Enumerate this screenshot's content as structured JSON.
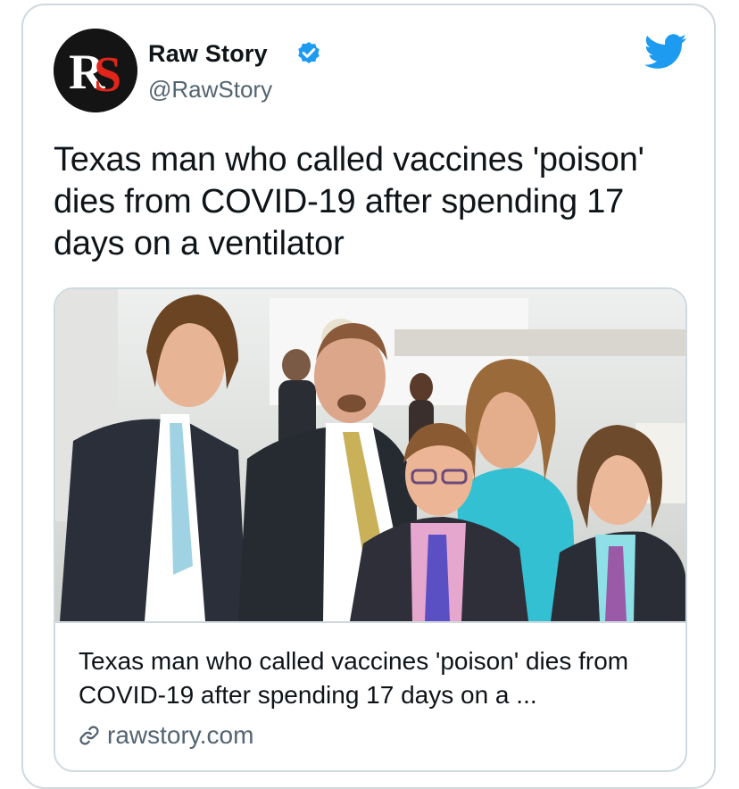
{
  "author": {
    "name": "Raw Story",
    "handle": "@RawStory",
    "avatar_text": "RS",
    "verified": true
  },
  "tweet": {
    "text": "Texas man who called vaccines 'poison' dies from COVID-19 after spending 17 days on a ventilator"
  },
  "link_card": {
    "title": "Texas man who called vaccines 'poison' dies from COVID-19 after spending 17 days on a ...",
    "domain": "rawstory.com"
  },
  "icons": {
    "verified": "verified-badge-icon",
    "brand": "twitter-bird-icon",
    "link": "link-icon"
  },
  "colors": {
    "twitter_blue": "#1d9bf0",
    "text_primary": "#0f1419",
    "text_secondary": "#536471",
    "border": "#cfd9de",
    "rs_red": "#e1251b"
  }
}
